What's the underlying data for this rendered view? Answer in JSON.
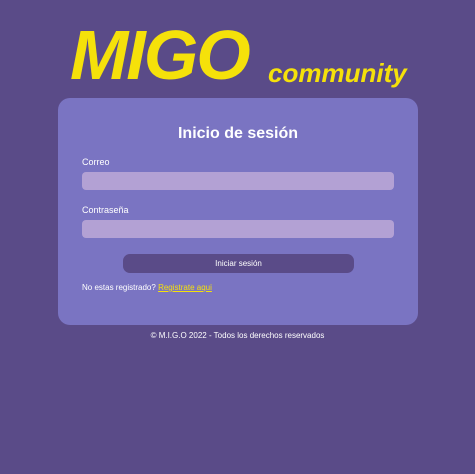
{
  "brand": {
    "name": "MIGO",
    "tagline": "community",
    "color": "#f5e10a"
  },
  "login": {
    "title": "Inicio de sesión",
    "email_label": "Correo",
    "email_value": "",
    "password_label": "Contraseña",
    "password_value": "",
    "submit_label": "Iniciar sesión",
    "register_prompt": "No estas registrado?",
    "register_link": "Registrate aqui"
  },
  "footer": {
    "text": "© M.I.G.O 2022 - Todos los derechos reservados"
  },
  "colors": {
    "background": "#5a4b88",
    "card": "#7a74c2",
    "input": "#b3a1d4",
    "accent": "#f5e10a"
  }
}
